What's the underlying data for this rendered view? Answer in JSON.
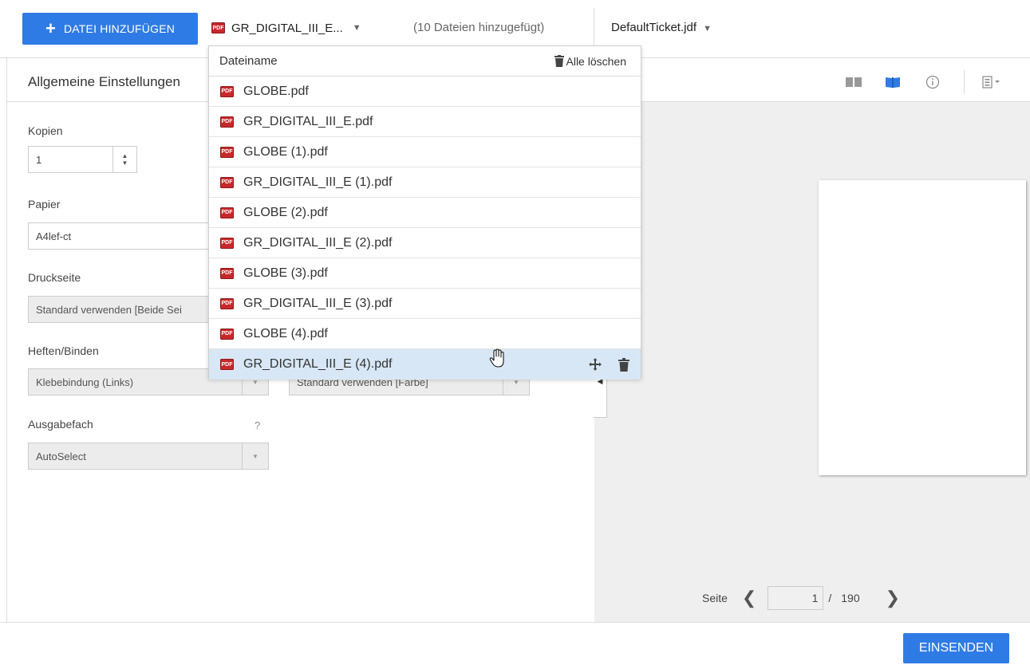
{
  "toolbar": {
    "add_file_label": "DATEI HINZUFÜGEN",
    "current_file": "GR_DIGITAL_III_E...",
    "files_added": "(10 Dateien hinzugefügt)",
    "ticket": "DefaultTicket.jdf"
  },
  "settings": {
    "title": "Allgemeine Einstellungen",
    "copies_label": "Kopien",
    "copies_value": "1",
    "paper_label": "Papier",
    "paper_value": "A4lef-ct",
    "print_side_label": "Druckseite",
    "print_side_value": "Standard verwenden [Beide Sei",
    "staple_label": "Heften/Binden",
    "staple_value": "Klebebindung (Links)",
    "color_value": "Standard verwenden [Farbe]",
    "output_label": "Ausgabefach",
    "output_help": "?",
    "output_value": "AutoSelect"
  },
  "file_list": {
    "header": "Dateiname",
    "clear_all": "Alle löschen",
    "pdf_badge": "PDF",
    "files": [
      "GLOBE.pdf",
      "GR_DIGITAL_III_E.pdf",
      "GLOBE (1).pdf",
      "GR_DIGITAL_III_E (1).pdf",
      "GLOBE (2).pdf",
      "GR_DIGITAL_III_E (2).pdf",
      "GLOBE (3).pdf",
      "GR_DIGITAL_III_E (3).pdf",
      "GLOBE (4).pdf",
      "GR_DIGITAL_III_E (4).pdf"
    ],
    "hovered_index": 9
  },
  "pager": {
    "label": "Seite",
    "current": "1",
    "separator": "/",
    "total": "190"
  },
  "submit_label": "EINSENDEN",
  "icons": [
    "plus-icon",
    "pdf-file-icon",
    "chevron-down-icon",
    "trash-icon",
    "move-icon",
    "hand-cursor-icon",
    "two-page-view-icon",
    "book-view-icon",
    "info-icon",
    "layout-menu-icon",
    "chevron-left-icon",
    "chevron-right-icon"
  ],
  "colors": {
    "accent": "#2f7be5",
    "hover_row": "#d7e7f5",
    "pdf_red": "#c8282a"
  }
}
